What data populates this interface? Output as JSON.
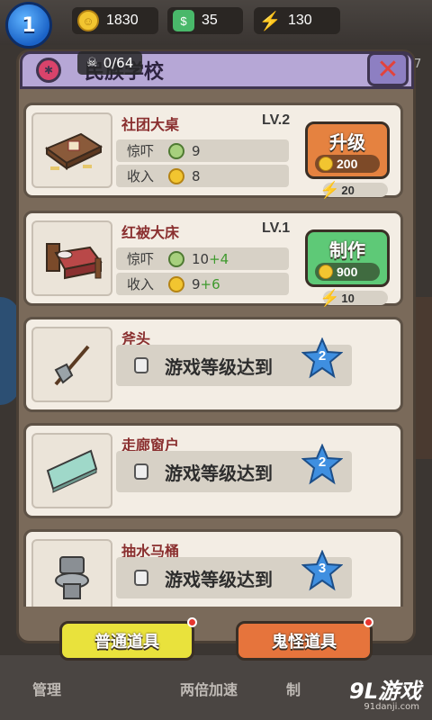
{
  "topbar": {
    "level": "1",
    "coins": "1830",
    "cash": "35",
    "energy": "130"
  },
  "panel": {
    "title": "民族学校",
    "counter": "0/64",
    "close_side_number": "7"
  },
  "items": [
    {
      "name": "社团大桌",
      "level": "LV.2",
      "scare_label": "惊吓",
      "scare_value": "9",
      "scare_bonus": "",
      "income_label": "收入",
      "income_value": "8",
      "income_bonus": "",
      "action_label": "升级",
      "action_cost": "200",
      "energy_cost": "20",
      "action_color": "#e58240"
    },
    {
      "name": "红被大床",
      "level": "LV.1",
      "scare_label": "惊吓",
      "scare_value": "10",
      "scare_bonus": "+4",
      "income_label": "收入",
      "income_value": "9",
      "income_bonus": "+6",
      "action_label": "制作",
      "action_cost": "900",
      "energy_cost": "10",
      "action_color": "#5ec977"
    },
    {
      "name": "斧头",
      "lock_text": "游戏等级达到",
      "required_level": "2"
    },
    {
      "name": "走廊窗户",
      "lock_text": "游戏等级达到",
      "required_level": "2"
    },
    {
      "name": "抽水马桶",
      "lock_text": "游戏等级达到",
      "required_level": "3"
    }
  ],
  "footer": {
    "normal_props": "普通道具",
    "ghost_props": "鬼怪道具"
  },
  "bottomnav": {
    "manage": "管理",
    "double_speed": "两倍加速",
    "partial": "制"
  },
  "watermark": {
    "brand": "9L游戏",
    "url": "91danji.com"
  }
}
